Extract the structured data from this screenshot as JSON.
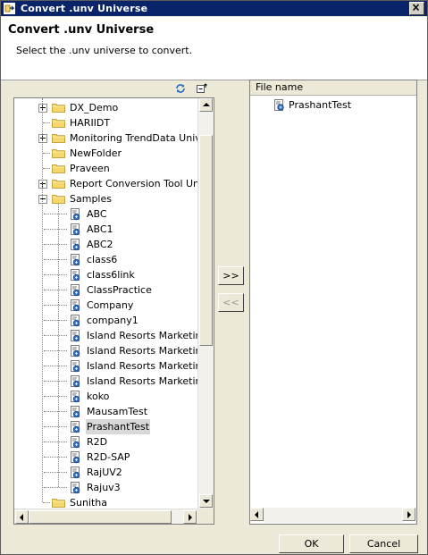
{
  "window": {
    "title": "Convert .unv Universe",
    "icon": "app-icon",
    "close_icon": "close-icon"
  },
  "header": {
    "title": "Convert .unv Universe",
    "subtitle": "Select the .unv universe to convert."
  },
  "tree": {
    "toolbar": {
      "refresh_icon": "refresh-icon",
      "collapse_icon": "collapse-all-icon"
    },
    "items": [
      {
        "label": "DX_Demo",
        "type": "folder",
        "expander": "plus",
        "level": 0
      },
      {
        "label": "HARIIDT",
        "type": "folder",
        "expander": "none",
        "level": 0
      },
      {
        "label": "Monitoring TrendData Universe",
        "type": "folder",
        "expander": "plus",
        "level": 0
      },
      {
        "label": "NewFolder",
        "type": "folder",
        "expander": "none",
        "level": 0
      },
      {
        "label": "Praveen",
        "type": "folder",
        "expander": "none",
        "level": 0
      },
      {
        "label": "Report Conversion Tool Universe",
        "type": "folder",
        "expander": "plus",
        "level": 0
      },
      {
        "label": "Samples",
        "type": "folder",
        "expander": "minus",
        "level": 0
      },
      {
        "label": "ABC",
        "type": "universe",
        "level": 1
      },
      {
        "label": "ABC1",
        "type": "universe",
        "level": 1
      },
      {
        "label": "ABC2",
        "type": "universe",
        "level": 1
      },
      {
        "label": "class6",
        "type": "universe",
        "level": 1
      },
      {
        "label": "class6link",
        "type": "universe",
        "level": 1
      },
      {
        "label": "ClassPractice",
        "type": "universe",
        "level": 1
      },
      {
        "label": "Company",
        "type": "universe",
        "level": 1
      },
      {
        "label": "company1",
        "type": "universe",
        "level": 1
      },
      {
        "label": "Island Resorts Marketing",
        "type": "universe",
        "level": 1
      },
      {
        "label": "Island Resorts Marketing_",
        "type": "universe",
        "level": 1
      },
      {
        "label": "Island Resorts Marketing_",
        "type": "universe",
        "level": 1
      },
      {
        "label": "Island Resorts Marketing_",
        "type": "universe",
        "level": 1
      },
      {
        "label": "koko",
        "type": "universe",
        "level": 1
      },
      {
        "label": "MausamTest",
        "type": "universe",
        "level": 1
      },
      {
        "label": "PrashantTest",
        "type": "universe",
        "level": 1,
        "selected": true
      },
      {
        "label": "R2D",
        "type": "universe",
        "level": 1
      },
      {
        "label": "R2D-SAP",
        "type": "universe",
        "level": 1
      },
      {
        "label": "RajUV2",
        "type": "universe",
        "level": 1
      },
      {
        "label": "Rajuv3",
        "type": "universe",
        "level": 1
      },
      {
        "label": "Sunitha",
        "type": "folder",
        "expander": "none",
        "level": 0
      }
    ]
  },
  "move": {
    "add_label": ">>",
    "remove_label": "<<"
  },
  "list": {
    "column_header": "File name",
    "items": [
      {
        "label": "PrashantTest",
        "icon": "universe-icon"
      }
    ]
  },
  "footer": {
    "ok_label": "OK",
    "cancel_label": "Cancel"
  },
  "colors": {
    "titlebar": "#0a246a",
    "dialog_bg": "#ece9d8",
    "folder": "#f5d76e",
    "selected_row": "#d8d8d8"
  }
}
